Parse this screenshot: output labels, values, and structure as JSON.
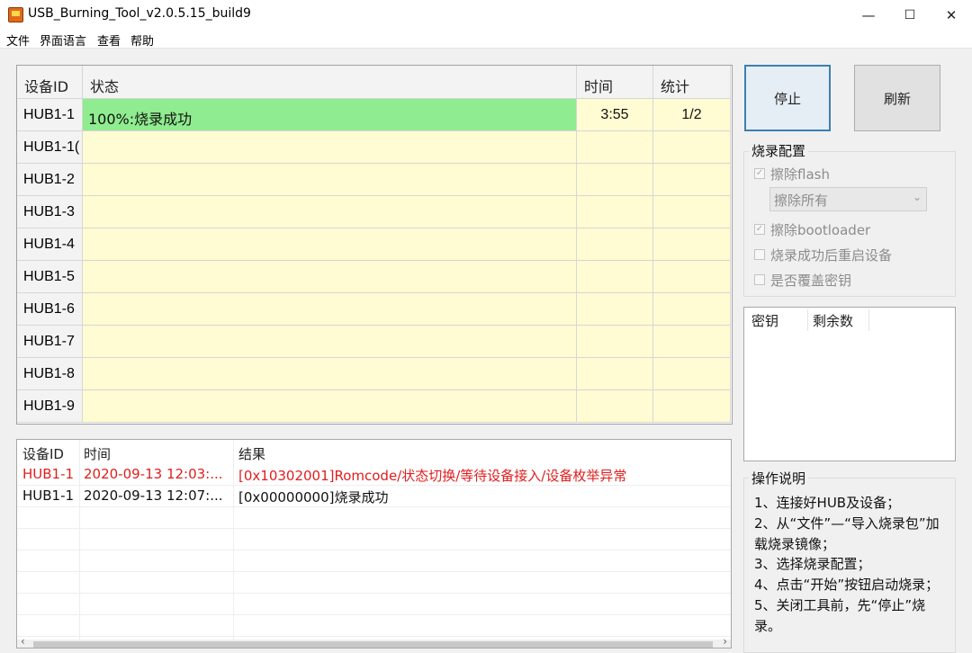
{
  "window": {
    "title": "USB_Burning_Tool_v2.0.5.15_build9",
    "controls": {
      "minimize": "—",
      "maximize": "☐",
      "close": "✕"
    }
  },
  "menu": [
    "文件",
    "界面语言",
    "查看",
    "帮助"
  ],
  "device_grid": {
    "headers": {
      "id": "设备ID",
      "status": "状态",
      "time": "时间",
      "stats": "统计"
    },
    "rows": [
      {
        "id": "HUB1-1",
        "status": "100%:烧录成功",
        "time": "3:55",
        "stats": "1/2",
        "success": true
      },
      {
        "id": "HUB1-1(",
        "status": "",
        "time": "",
        "stats": ""
      },
      {
        "id": "HUB1-2",
        "status": "",
        "time": "",
        "stats": ""
      },
      {
        "id": "HUB1-3",
        "status": "",
        "time": "",
        "stats": ""
      },
      {
        "id": "HUB1-4",
        "status": "",
        "time": "",
        "stats": ""
      },
      {
        "id": "HUB1-5",
        "status": "",
        "time": "",
        "stats": ""
      },
      {
        "id": "HUB1-6",
        "status": "",
        "time": "",
        "stats": ""
      },
      {
        "id": "HUB1-7",
        "status": "",
        "time": "",
        "stats": ""
      },
      {
        "id": "HUB1-8",
        "status": "",
        "time": "",
        "stats": ""
      },
      {
        "id": "HUB1-9",
        "status": "",
        "time": "",
        "stats": ""
      }
    ]
  },
  "buttons": {
    "stop": "停止",
    "refresh": "刷新"
  },
  "burn_config": {
    "title": "烧录配置",
    "erase_flash": {
      "label": "擦除flash",
      "checked": true
    },
    "erase_mode": "擦除所有",
    "erase_bootloader": {
      "label": "擦除bootloader",
      "checked": true
    },
    "reboot_after": {
      "label": "烧录成功后重启设备",
      "checked": false
    },
    "overwrite_key": {
      "label": "是否覆盖密钥",
      "checked": false
    }
  },
  "key_list": {
    "col_key": "密钥",
    "col_remain": "剩余数"
  },
  "log": {
    "headers": {
      "id": "设备ID",
      "time": "时间",
      "result": "结果"
    },
    "rows": [
      {
        "id": "HUB1-1",
        "time": "2020-09-13 12:03:...",
        "result": "[0x10302001]Romcode/状态切换/等待设备接入/设备枚举异常",
        "error": true
      },
      {
        "id": "HUB1-1",
        "time": "2020-09-13 12:07:...",
        "result": "[0x00000000]烧录成功",
        "error": false
      }
    ],
    "scroll_left": "‹",
    "scroll_right": "›"
  },
  "help": {
    "title": "操作说明",
    "text": "1、连接好HUB及设备；\n2、从“文件”—“导入烧录包”加载烧录镜像；\n3、选择烧录配置；\n4、点击“开始”按钮启动烧录；\n5、关闭工具前，先“停止”烧录。"
  },
  "colors": {
    "success_row": "#90ec90",
    "idle_row": "#fffbd2",
    "error_text": "#e01e1e",
    "default_button_border": "#3c7fb1"
  }
}
